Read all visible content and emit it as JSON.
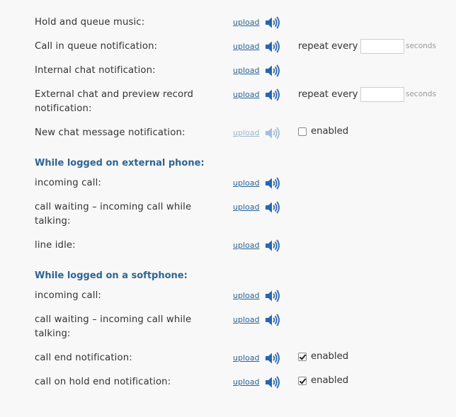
{
  "upload_label": "upload",
  "seconds_label": "seconds",
  "repeat_label": "repeat every",
  "enabled_label": "enabled",
  "general": {
    "hold_queue_music": "Hold and queue music:",
    "call_in_queue": "Call in queue notification:",
    "internal_chat": "Internal chat notification:",
    "external_chat": "External chat and preview record notification:",
    "new_chat_message": "New chat message notification:",
    "call_in_queue_repeat": "",
    "external_chat_repeat": "",
    "new_chat_enabled": false
  },
  "external_phone": {
    "heading": "While logged on external phone:",
    "incoming_call": "incoming call:",
    "call_waiting": "call waiting – incoming call while talking:",
    "line_idle": "line idle:"
  },
  "softphone": {
    "heading": "While logged on a softphone:",
    "incoming_call": "incoming call:",
    "call_waiting": "call waiting – incoming call while talking:",
    "call_end": "call end notification:",
    "call_on_hold_end": "call on hold end notification:",
    "call_end_enabled": true,
    "call_on_hold_end_enabled": true
  },
  "colors": {
    "link": "#2a6496",
    "heading": "#2f6492",
    "speaker": "#2866b0",
    "background": "#f8f8f8"
  },
  "icons": {
    "speaker": "speaker-volume-icon",
    "checkbox": "checkbox"
  }
}
